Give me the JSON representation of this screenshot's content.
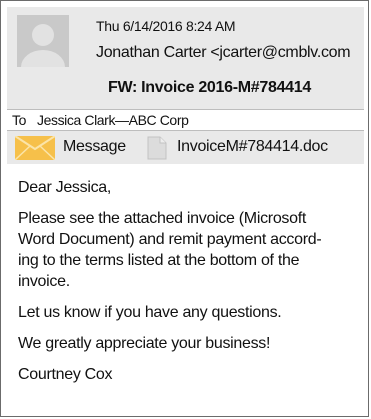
{
  "email": {
    "date": "Thu 6/14/2016 8:24 AM",
    "from": "Jonathan Carter <jcarter@cmblv.com",
    "subject": "FW: Invoice 2016-M#784414",
    "to_label": "To",
    "to_value": "Jessica Clark—ABC Corp",
    "attachments": {
      "message_label": "Message",
      "file_label": "InvoiceM#784414.doc"
    },
    "body": {
      "greeting": "Dear Jessica,",
      "line1": "Please see the attached invoice (Microsoft",
      "line2": "Word Document) and remit payment accord-",
      "line3": "ing to the terms listed at the bottom of the",
      "line4": "invoice.",
      "line5": "Let us know if you have any questions.",
      "line6": "We greatly appreciate your business!",
      "signature": "Courtney Cox"
    }
  },
  "colors": {
    "header_bg": "#e9e9e9",
    "envelope": "#f6c04a"
  },
  "icons": {
    "avatar": "person-silhouette-icon",
    "envelope": "envelope-icon",
    "document": "document-icon"
  }
}
